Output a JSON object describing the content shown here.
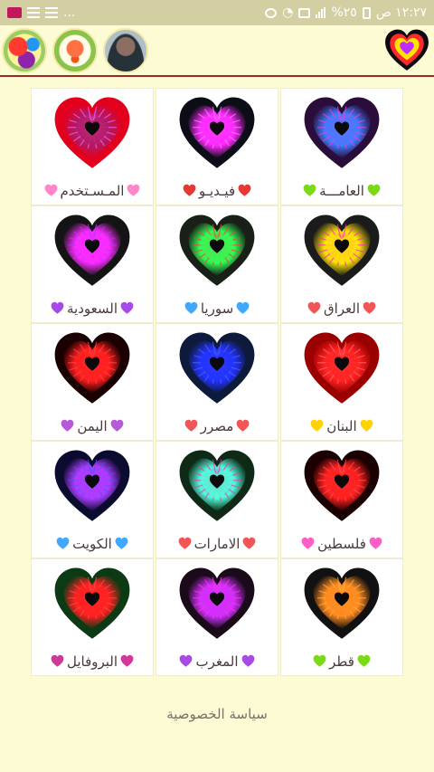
{
  "status_bar": {
    "time": "١٢:٢٧ ص",
    "battery": "%٢٥",
    "dots": "..."
  },
  "header": {
    "icons": [
      "app-icon-colorful",
      "app-icon-bell",
      "profile-avatar"
    ]
  },
  "cells": [
    {
      "label": "العامـــة",
      "emoji_color": "#7cd916",
      "emoji_icon": "green-heart-icon",
      "heart_outer": "#2a0d3a",
      "heart_inner": "#3f7bff",
      "heart_glow": "#ff3bd3"
    },
    {
      "label": "فيـديـو",
      "emoji_color": "#e53935",
      "emoji_icon": "tulip-icon",
      "heart_outer": "#0c0d16",
      "heart_inner": "#ff29ff",
      "heart_glow": "#ff80ff"
    },
    {
      "label": "المـسـتخدم",
      "emoji_color": "#ff86c8",
      "emoji_icon": "checkered-heart-icon",
      "heart_outer": "#e3001c",
      "heart_inner": "#b01b62",
      "heart_glow": "#ff5eff"
    },
    {
      "label": "العراق",
      "emoji_color": "#f25555",
      "emoji_icon": "red-heart-icon",
      "heart_outer": "#1b1b1b",
      "heart_inner": "#ffe600",
      "heart_glow": "#ff1fd3"
    },
    {
      "label": "سوريا",
      "emoji_color": "#40a9ff",
      "emoji_icon": "blue-heart-icon",
      "heart_outer": "#182018",
      "heart_inner": "#2eff55",
      "heart_glow": "#ff3b3b"
    },
    {
      "label": "السعودية",
      "emoji_color": "#a74be6",
      "emoji_icon": "purple-heart-icon",
      "heart_outer": "#141414",
      "heart_inner": "#ff2bff",
      "heart_glow": "#b235ff"
    },
    {
      "label": "البنان",
      "emoji_color": "#ffd200",
      "emoji_icon": "yellow-heart-icon",
      "heart_outer": "#9b0000",
      "heart_inner": "#ff2222",
      "heart_glow": "#ff6b6b"
    },
    {
      "label": "مصرر",
      "emoji_color": "#f25555",
      "emoji_icon": "red-heart-icon",
      "heart_outer": "#0d1a3c",
      "heart_inner": "#2233ff",
      "heart_glow": "#5060ff"
    },
    {
      "label": "اليمن",
      "emoji_color": "#b65ad8",
      "emoji_icon": "ribbon-heart-icon",
      "heart_outer": "#1a0000",
      "heart_inner": "#ff1e1e",
      "heart_glow": "#ff4646"
    },
    {
      "label": "فلسطين",
      "emoji_color": "#ff5ec7",
      "emoji_icon": "sparkling-heart-icon",
      "heart_outer": "#1a0000",
      "heart_inner": "#ff2020",
      "heart_glow": "#ff5050"
    },
    {
      "label": "الامارات",
      "emoji_color": "#f25555",
      "emoji_icon": "red-heart-icon",
      "heart_outer": "#0e2a16",
      "heart_inner": "#4dffd9",
      "heart_glow": "#ff2bbd"
    },
    {
      "label": "الكويت",
      "emoji_color": "#40a9ff",
      "emoji_icon": "blue-heart-icon",
      "heart_outer": "#0b0b30",
      "heart_inner": "#b43bff",
      "heart_glow": "#3a5bff"
    },
    {
      "label": "قطر",
      "emoji_color": "#7cd916",
      "emoji_icon": "green-heart-icon",
      "heart_outer": "#111",
      "heart_inner": "#ff8a1f",
      "heart_glow": "#ffb347"
    },
    {
      "label": "المغرب",
      "emoji_color": "#a74be6",
      "emoji_icon": "purple-heart-icon",
      "heart_outer": "#1a0a1a",
      "heart_inner": "#d12fff",
      "heart_glow": "#ff36d9"
    },
    {
      "label": "البروفايل",
      "emoji_color": "#d1389a",
      "emoji_icon": "heart-exclamation-icon",
      "heart_outer": "#0b3a14",
      "heart_inner": "#ff2020",
      "heart_glow": "#ff4b4b"
    }
  ],
  "footer": {
    "privacy_label": "سياسة الخصوصية"
  }
}
